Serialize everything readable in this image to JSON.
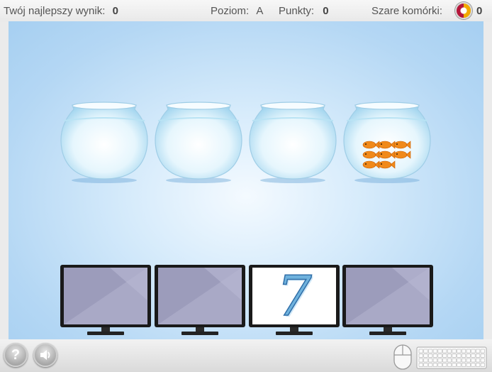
{
  "header": {
    "best_score_label": "Twój najlepszy wynik:",
    "best_score_value": "0",
    "level_label": "Poziom:",
    "level_value": "A",
    "points_label": "Punkty:",
    "points_value": "0",
    "gray_cells_label": "Szare komórki:",
    "gray_cells_value": "0",
    "gray_cells_icon": "brain-icon"
  },
  "game": {
    "bowls": [
      {
        "fish_count": 0
      },
      {
        "fish_count": 0
      },
      {
        "fish_count": 0
      },
      {
        "fish_count": 8
      }
    ],
    "monitors": [
      {
        "number": ""
      },
      {
        "number": ""
      },
      {
        "number": "7"
      },
      {
        "number": ""
      }
    ],
    "fish_color": "#f08a1a"
  },
  "footer": {
    "help_label": "?",
    "help_icon": "help-icon",
    "sound_icon": "speaker-icon",
    "mouse_icon": "mouse-icon",
    "keyboard_icon": "keyboard-icon"
  }
}
